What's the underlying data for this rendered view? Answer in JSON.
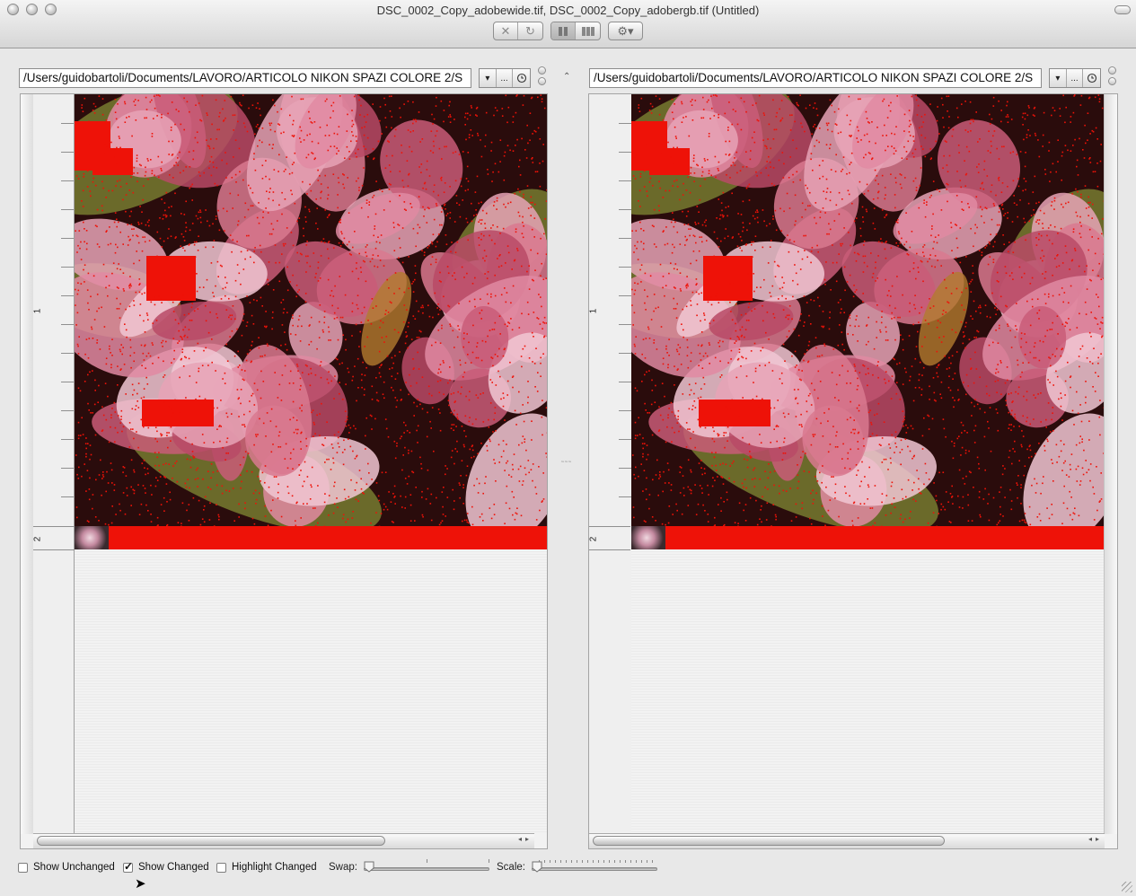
{
  "window": {
    "title": "DSC_0002_Copy_adobewide.tif, DSC_0002_Copy_adobergb.tif (Untitled)"
  },
  "toolbar": {
    "stop_icon": "x-icon",
    "refresh_icon": "refresh-icon",
    "layout_icons": [
      "two-columns-icon",
      "three-columns-icon"
    ],
    "action_icon": "gear-icon"
  },
  "left_pane": {
    "path": "/Users/guidobartoli/Documents/LAVORO/ARTICOLO NIKON SPAZI COLORE 2/S",
    "dropdown_glyph": "▾",
    "ellipsis_label": "...",
    "history_icon": "history-icon",
    "rows": [
      "1",
      "2"
    ]
  },
  "right_pane": {
    "path": "/Users/guidobartoli/Documents/LAVORO/ARTICOLO NIKON SPAZI COLORE 2/S",
    "dropdown_glyph": "▾",
    "ellipsis_label": "...",
    "history_icon": "history-icon",
    "rows": [
      "1",
      "2"
    ]
  },
  "options": {
    "show_unchanged": {
      "label": "Show Unchanged",
      "checked": false
    },
    "show_changed": {
      "label": "Show Changed",
      "checked": true
    },
    "highlight_changed": {
      "label": "Highlight Changed",
      "checked": false
    },
    "swap_label": "Swap:",
    "scale_label": "Scale:"
  },
  "colors": {
    "diff_highlight": "#ee1208",
    "flower_pink": "#d9798f",
    "leaf_green": "#6b6a2a"
  }
}
